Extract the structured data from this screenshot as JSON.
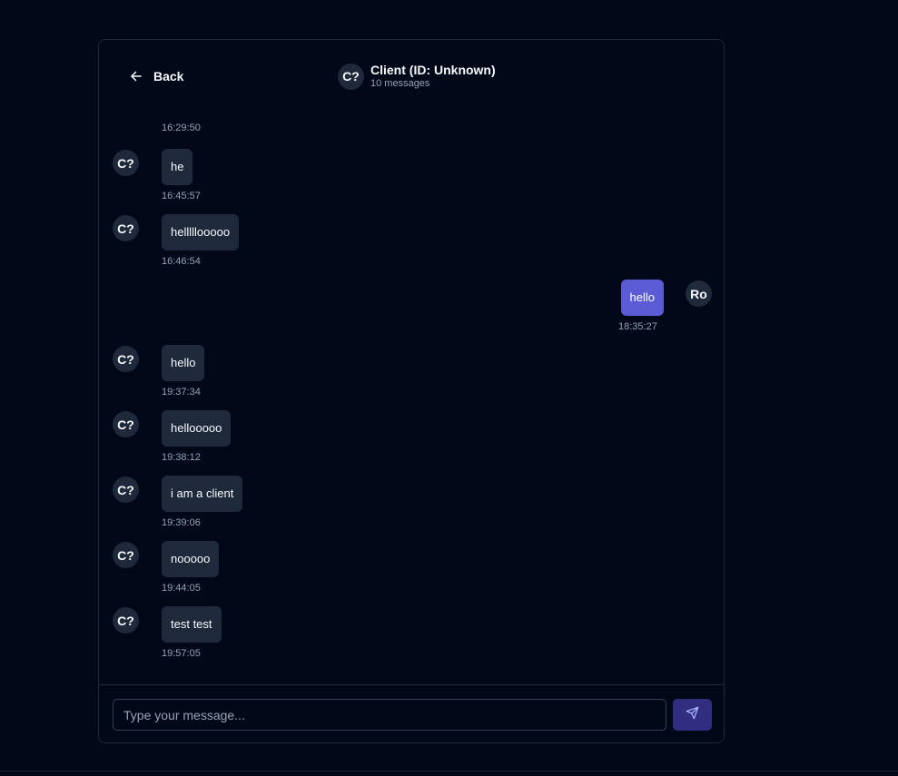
{
  "header": {
    "back_label": "Back",
    "client_initials": "C?",
    "client_title": "Client (ID: Unknown)",
    "message_count": "10 messages"
  },
  "messages": [
    {
      "direction": "in",
      "avatar": "",
      "text": "",
      "time": "16:29:50"
    },
    {
      "direction": "in",
      "avatar": "C?",
      "text": "he",
      "time": "16:45:57"
    },
    {
      "direction": "in",
      "avatar": "C?",
      "text": "helllllooooo",
      "time": "16:46:54"
    },
    {
      "direction": "out",
      "avatar": "Ro",
      "text": "hello",
      "time": "18:35:27"
    },
    {
      "direction": "in",
      "avatar": "C?",
      "text": "hello",
      "time": "19:37:34"
    },
    {
      "direction": "in",
      "avatar": "C?",
      "text": "hellooooo",
      "time": "19:38:12"
    },
    {
      "direction": "in",
      "avatar": "C?",
      "text": "i am a client",
      "time": "19:39:06"
    },
    {
      "direction": "in",
      "avatar": "C?",
      "text": "nooooo",
      "time": "19:44:05"
    },
    {
      "direction": "in",
      "avatar": "C?",
      "text": "test test",
      "time": "19:57:05"
    }
  ],
  "composer": {
    "placeholder": "Type your message...",
    "value": ""
  },
  "icons": {
    "back": "arrow-left-icon",
    "send": "send-icon"
  },
  "colors": {
    "background": "#020817",
    "bubble_in": "#1e293b",
    "bubble_out": "#5b5bd6",
    "send_button": "#312e81"
  }
}
